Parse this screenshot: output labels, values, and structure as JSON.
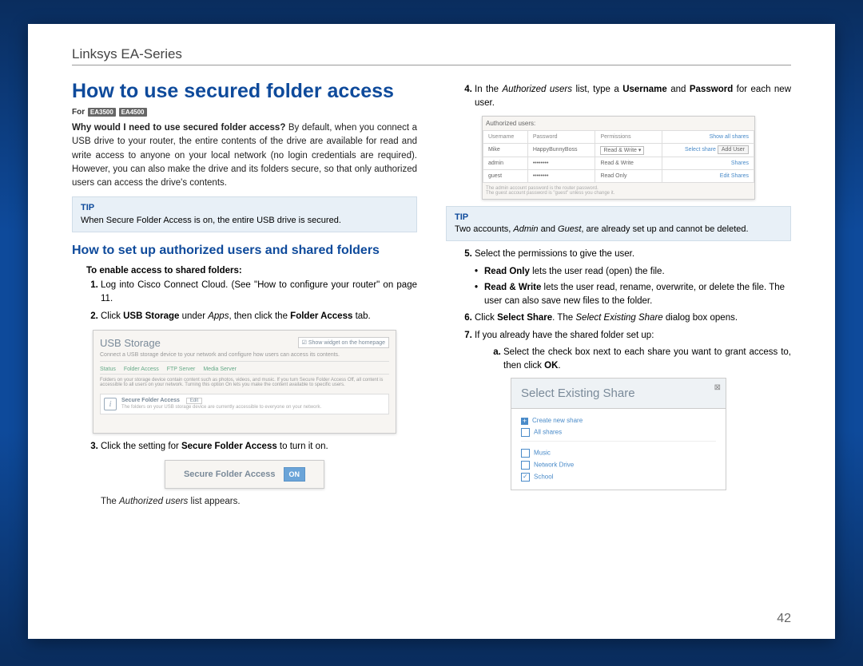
{
  "header": {
    "product_line": "Linksys EA-Series"
  },
  "title": "How to use secured folder access",
  "for_label": "For",
  "models": [
    "EA3500",
    "EA4500"
  ],
  "intro": {
    "question": "Why would I need to use secured folder access?",
    "answer": " By default, when you connect a USB drive to your router, the entire contents of the drive are available for read and write access to anyone on your local network (no login credentials are required). However, you can also make the drive and its folders secure, so that only authorized users can access the drive's contents."
  },
  "tip1": {
    "label": "TIP",
    "text": "When Secure Folder Access is on, the entire USB drive is secured."
  },
  "section2_title": "How to set up authorized users and shared folders",
  "enable_heading": "To enable access to shared folders:",
  "step1": {
    "a": "Log into Cisco Connect Cloud. (See \"How to configure your router\" on page 11."
  },
  "step2": {
    "a": "Click ",
    "b": "USB Storage",
    "c": " under ",
    "d": "Apps",
    "e": ", then click the ",
    "f": "Folder Access",
    "g": " tab."
  },
  "usb_shot": {
    "title": "USB Storage",
    "widget": "Show widget on the homepage",
    "desc": "Connect a USB storage device to your network and configure how users can access its contents.",
    "tabs": [
      "Status",
      "Folder Access",
      "FTP Server",
      "Media Server"
    ],
    "body": "Folders on your storage device contain content such as photos, videos, and music. If you turn Secure Folder Access Off, all content is accessible to all users on your network. Turning this option On lets you make the content available to specific users.",
    "sfa_label": "Secure Folder Access",
    "sfa_btn": "Edit",
    "sfa_note": "The folders on your USB storage device are currently accessible to everyone on your network."
  },
  "step3": {
    "a": "Click the setting for ",
    "b": "Secure Folder Access",
    "c": " to turn it on."
  },
  "sfa_box": {
    "label": "Secure Folder Access",
    "state": "ON"
  },
  "step3_after": {
    "a": "The ",
    "b": "Authorized users",
    "c": " list appears."
  },
  "step4": {
    "a": "In the ",
    "b": "Authorized users",
    "c": " list, type a ",
    "d": "Username",
    "e": " and ",
    "f": "Password",
    "g": " for each new user."
  },
  "auth_table": {
    "caption": "Authorized users:",
    "cols": [
      "Username",
      "Password",
      "Permissions"
    ],
    "show_all": "Show all shares",
    "rows": [
      {
        "user": "Mike",
        "pass": "HappyBunnyBoss",
        "perm": "Read & Write",
        "a1": "Select share",
        "a2": "Add User"
      },
      {
        "user": "admin",
        "pass": "••••••••",
        "perm": "Read & Write",
        "a1": "",
        "a2": "Shares"
      },
      {
        "user": "guest",
        "pass": "••••••••",
        "perm": "Read Only",
        "a1": "Edit",
        "a2": "Shares"
      }
    ],
    "note1": "The admin account password is the router password.",
    "note2": "The guest account password is \"guest\" unless you change it."
  },
  "tip2": {
    "label": "TIP",
    "a": "Two accounts, ",
    "b": "Admin",
    "c": " and ",
    "d": "Guest",
    "e": ", are already set up and cannot be deleted."
  },
  "step5": "Select the permissions to give the user.",
  "bullet_ro": {
    "a": "Read Only",
    "b": " lets the user read (open) the file."
  },
  "bullet_rw": {
    "a": "Read & Write",
    "b": " lets the user read, rename, overwrite, or delete the file. The user can also save new files to the folder."
  },
  "step6": {
    "a": "Click ",
    "b": "Select Share",
    "c": ". The ",
    "d": "Select Existing Share",
    "e": " dialog box opens."
  },
  "step7": "If you already have the shared folder set up:",
  "step7a": {
    "a": "Select the check box next to each share you want to grant access to, then click ",
    "b": "OK",
    "c": "."
  },
  "share_dialog": {
    "title": "Select Existing Share",
    "create": "Create new share",
    "all": "All shares",
    "items": [
      {
        "label": "Music",
        "checked": false
      },
      {
        "label": "Network Drive",
        "checked": false
      },
      {
        "label": "School",
        "checked": true
      }
    ]
  },
  "page_number": "42"
}
